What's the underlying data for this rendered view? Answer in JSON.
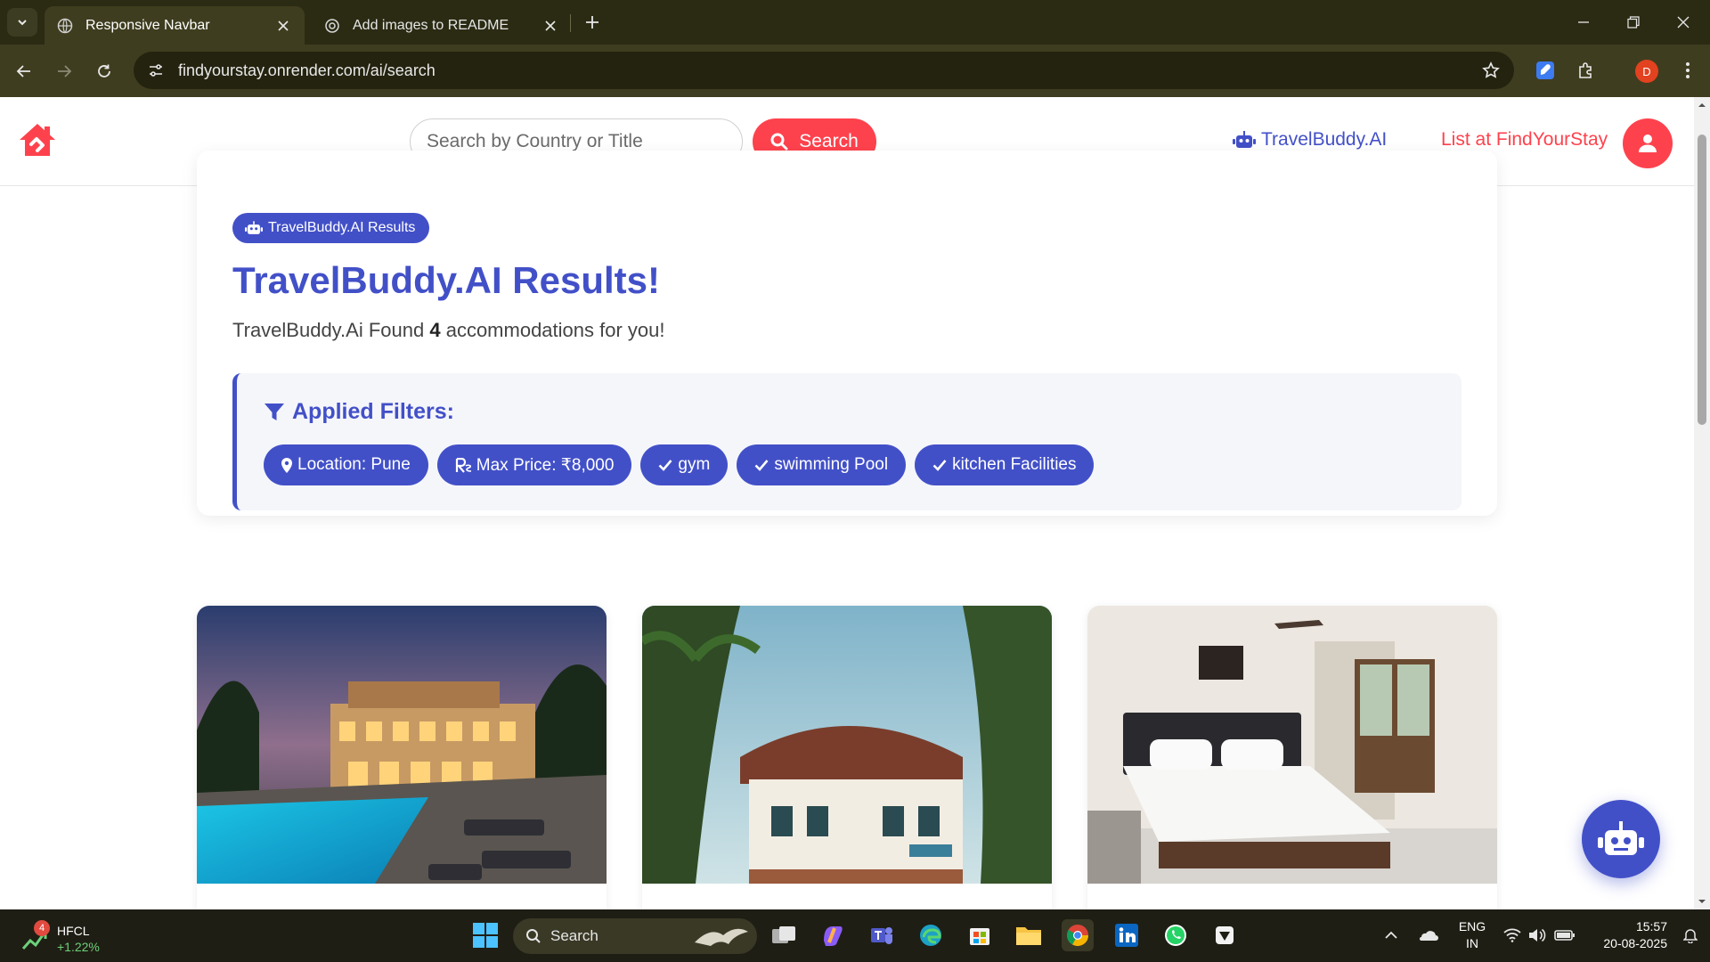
{
  "browser": {
    "tabs": [
      {
        "label": "Responsive Navbar",
        "active": true
      },
      {
        "label": "Add images to README",
        "active": false
      }
    ],
    "url": "findyourstay.onrender.com/ai/search",
    "profile_initial": "D"
  },
  "site": {
    "search_placeholder": "Search by Country or Title",
    "search_button": "Search",
    "ai_link": "TravelBuddy.AI",
    "list_link": "List at FindYourStay"
  },
  "results": {
    "badge": "TravelBuddy.AI Results",
    "title": "TravelBuddy.AI Results!",
    "sub_prefix": "TravelBuddy.Ai Found ",
    "count": "4",
    "sub_suffix": " accommodations for you!",
    "filters_heading": "Applied Filters:",
    "filters": [
      {
        "icon": "map-pin-icon",
        "label": "Location: Pune"
      },
      {
        "icon": "rupee-icon",
        "label": "Max Price: ₹8,000"
      },
      {
        "icon": "check-icon",
        "label": "gym"
      },
      {
        "icon": "check-icon",
        "label": "swimming Pool"
      },
      {
        "icon": "check-icon",
        "label": "kitchen Facilities"
      }
    ]
  },
  "listings": [
    {
      "image": "villa-pool-night"
    },
    {
      "image": "colonial-house-palms"
    },
    {
      "image": "hotel-bedroom"
    }
  ],
  "taskbar": {
    "stock_badge": "4",
    "stock_name": "HFCL",
    "stock_change": "+1.22%",
    "search_label": "Search",
    "lang_line1": "ENG",
    "lang_line2": "IN",
    "time": "15:57",
    "date": "20-08-2025"
  },
  "colors": {
    "brand": "#fe424d",
    "accent": "#4250c8",
    "stock_up": "#6cd07a"
  }
}
